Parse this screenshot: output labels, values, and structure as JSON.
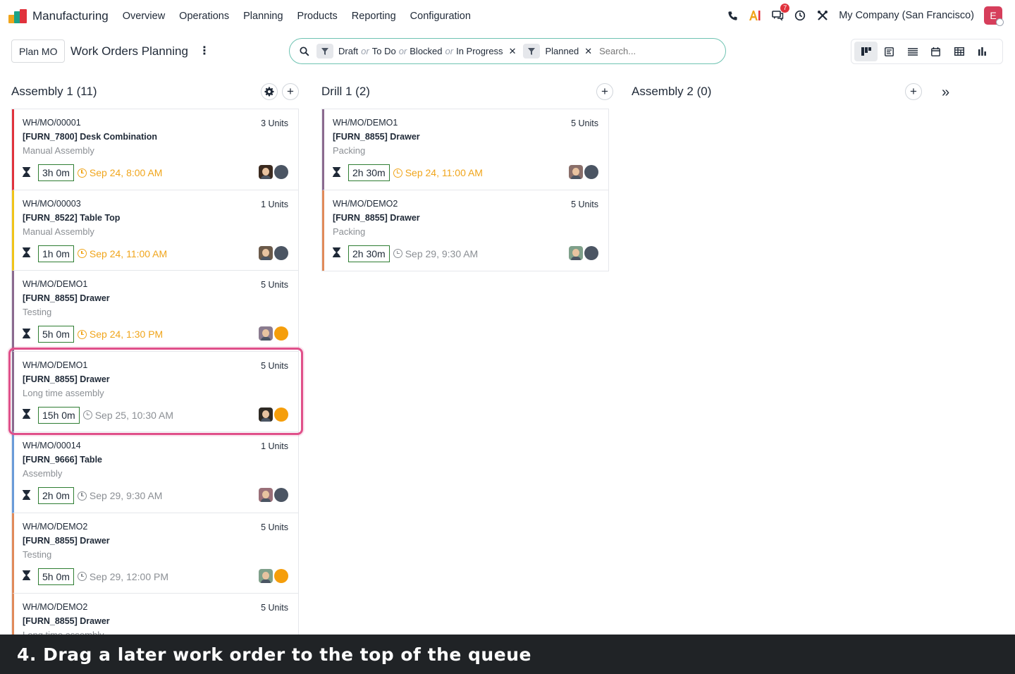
{
  "topbar": {
    "app_name": "Manufacturing",
    "menu": [
      "Overview",
      "Operations",
      "Planning",
      "Products",
      "Reporting",
      "Configuration"
    ],
    "icons": [
      "phone-icon",
      "ai-icon",
      "chat-icon",
      "clock-icon",
      "tools-icon"
    ],
    "message_count": "7",
    "company": "My Company (San Francisco)",
    "user_initial": "E",
    "accent_color": "#d63e5b"
  },
  "control": {
    "plan_button": "Plan MO",
    "title": "Work Orders Planning",
    "filters": [
      {
        "parts": [
          "Draft",
          "To Do",
          "Blocked",
          "In Progress"
        ],
        "or": "or"
      },
      {
        "parts": [
          "Planned"
        ],
        "or": "or"
      }
    ],
    "search_placeholder": "Search...",
    "views": [
      "kanban-view",
      "form-view",
      "list-view",
      "calendar-view",
      "pivot-view",
      "graph-view"
    ]
  },
  "columns": [
    {
      "title": "Assembly 1 (11)",
      "has_settings": true,
      "cards": [
        {
          "ref": "WH/MO/00001",
          "units": "3 Units",
          "product": "[FURN_7800] Desk Combination",
          "step": "Manual Assembly",
          "duration": "3h 0m",
          "date": "Sep 24, 8:00 AM",
          "late": true,
          "color": "#e0323c",
          "status_color": "#4b5563",
          "face": "#3b2a1f"
        },
        {
          "ref": "WH/MO/00003",
          "units": "1 Units",
          "product": "[FURN_8522] Table Top",
          "step": "Manual Assembly",
          "duration": "1h 0m",
          "date": "Sep 24, 11:00 AM",
          "late": true,
          "color": "#f0c419",
          "status_color": "#4b5563",
          "face": "#6b5a4a"
        },
        {
          "ref": "WH/MO/DEMO1",
          "units": "5 Units",
          "product": "[FURN_8855] Drawer",
          "step": "Testing",
          "duration": "5h 0m",
          "date": "Sep 24, 1:30 PM",
          "late": true,
          "color": "#8b6a8f",
          "status_color": "#f59e0b",
          "face": "#8a7b8f"
        },
        {
          "ref": "WH/MO/DEMO1",
          "units": "5 Units",
          "product": "[FURN_8855] Drawer",
          "step": "Long time assembly",
          "duration": "15h 0m",
          "date": "Sep 25, 10:30 AM",
          "late": false,
          "color": "#8b6a8f",
          "status_color": "#f59e0b",
          "face": "#2f2a24"
        },
        {
          "ref": "WH/MO/00014",
          "units": "1 Units",
          "product": "[FURN_9666] Table",
          "step": "Assembly",
          "duration": "2h 0m",
          "date": "Sep 29, 9:30 AM",
          "late": false,
          "color": "#6a9bd8",
          "status_color": "#4b5563",
          "face": "#9a6f78"
        },
        {
          "ref": "WH/MO/DEMO2",
          "units": "5 Units",
          "product": "[FURN_8855] Drawer",
          "step": "Testing",
          "duration": "5h 0m",
          "date": "Sep 29, 12:00 PM",
          "late": false,
          "color": "#e08a5a",
          "status_color": "#f59e0b",
          "face": "#7fa08a"
        },
        {
          "ref": "WH/MO/DEMO2",
          "units": "5 Units",
          "product": "[FURN_8855] Drawer",
          "step": "Long time assembly",
          "duration": "",
          "date": "",
          "late": false,
          "color": "#e08a5a",
          "status_color": "#4b5563",
          "face": "#555555"
        }
      ]
    },
    {
      "title": "Drill 1 (2)",
      "has_settings": false,
      "cards": [
        {
          "ref": "WH/MO/DEMO1",
          "units": "5 Units",
          "product": "[FURN_8855] Drawer",
          "step": "Packing",
          "duration": "2h 30m",
          "date": "Sep 24, 11:00 AM",
          "late": true,
          "color": "#8b6a8f",
          "status_color": "#4b5563",
          "face": "#8a6f6a"
        },
        {
          "ref": "WH/MO/DEMO2",
          "units": "5 Units",
          "product": "[FURN_8855] Drawer",
          "step": "Packing",
          "duration": "2h 30m",
          "date": "Sep 29, 9:30 AM",
          "late": false,
          "color": "#e08a5a",
          "status_color": "#4b5563",
          "face": "#7fa08a"
        }
      ]
    },
    {
      "title": "Assembly 2 (0)",
      "has_settings": false,
      "cards": []
    }
  ],
  "caption": "4. Drag a later work order to the top of the queue"
}
